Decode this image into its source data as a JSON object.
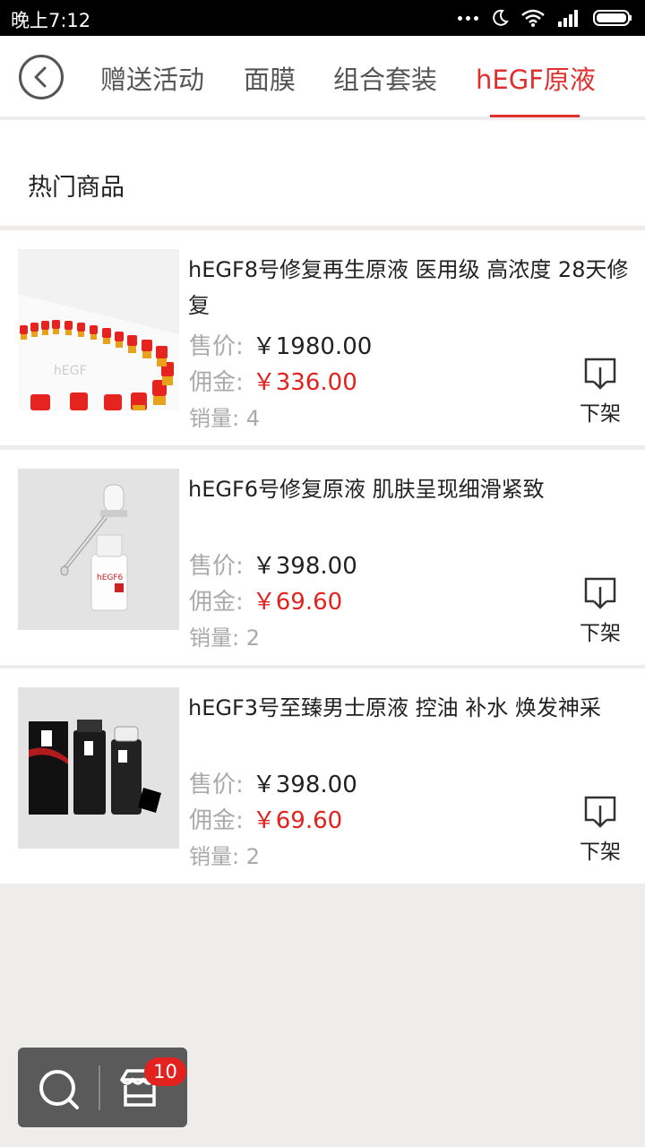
{
  "status_bar": {
    "time": "晚上7:12",
    "icons": [
      "more-dots-icon",
      "moon-icon",
      "wifi-icon",
      "signal-icon",
      "battery-icon"
    ]
  },
  "header": {
    "back_icon": "chevron-left-icon",
    "tabs": [
      {
        "label": "赠送活动",
        "active": false
      },
      {
        "label": "面膜",
        "active": false
      },
      {
        "label": "组合套装",
        "active": false
      },
      {
        "label": "hEGF原液",
        "active": true
      }
    ]
  },
  "section": {
    "title": "热门商品"
  },
  "products": [
    {
      "name": "hEGF8号修复再生原液 医用级 高浓度 28天修复",
      "price_label": "售价:",
      "price": "￥1980.00",
      "commission_label": "佣金:",
      "commission": "￥336.00",
      "sales": "销量: 4",
      "action": "下架"
    },
    {
      "name": "hEGF6号修复原液 肌肤呈现细滑紧致",
      "price_label": "售价:",
      "price": "￥398.00",
      "commission_label": "佣金:",
      "commission": "￥69.60",
      "sales": "销量: 2",
      "action": "下架"
    },
    {
      "name": "hEGF3号至臻男士原液 控油 补水 焕发神采",
      "price_label": "售价:",
      "price": "￥398.00",
      "commission_label": "佣金:",
      "commission": "￥69.60",
      "sales": "销量: 2",
      "action": "下架"
    }
  ],
  "float_bar": {
    "search_icon": "search-icon",
    "store_icon": "store-icon",
    "badge": "10"
  },
  "colors": {
    "accent": "#e0302e",
    "price_red": "#e3211e",
    "background": "#efedeb"
  }
}
